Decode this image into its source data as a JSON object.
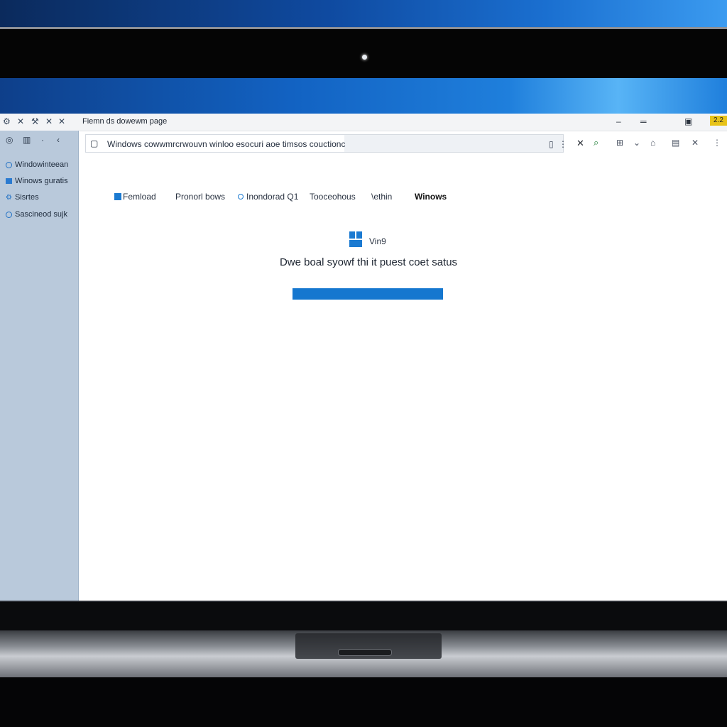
{
  "window": {
    "title": "Fiemn ds dowewm page",
    "clock_badge": "2.2"
  },
  "sidebar": {
    "items": [
      {
        "label": "Windowinteean",
        "icon": "circle-outline-icon"
      },
      {
        "label": "Winows guratis",
        "icon": "square-icon"
      },
      {
        "label": "Sisrtes",
        "icon": "settings-icon"
      },
      {
        "label": "Sascineod sujk",
        "icon": "circle-outline-icon"
      }
    ]
  },
  "address_bar": {
    "text": "Windows cowwmrcrwouvn winloo esocuri aoe timsos couctionc"
  },
  "nav": {
    "links": [
      {
        "label": "Femload",
        "icon": "square-icon"
      },
      {
        "label": "Pronorl bows"
      },
      {
        "label": "Inondorad Q1",
        "icon": "circle-outline-icon"
      },
      {
        "label": "Tooceohous"
      },
      {
        "label": "\\ethin",
        "icon": "slash-icon"
      },
      {
        "label": "Winows",
        "bold": true
      }
    ]
  },
  "main": {
    "logo_label": "Vin9",
    "status_text": "Dwe boal syowf thi it puest coet satus",
    "progress": 1.0
  },
  "colors": {
    "accent": "#1577cf",
    "sidebar_bg": "#b9c9db",
    "desktop_blue": "#1262c2"
  }
}
